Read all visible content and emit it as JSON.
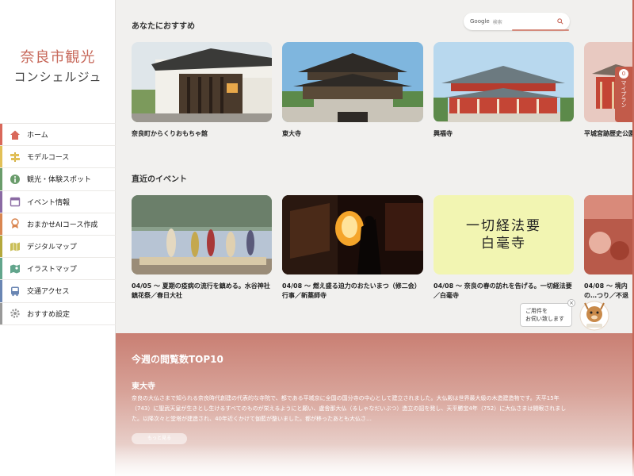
{
  "brand": {
    "main": "奈良市観光",
    "sub": "コンシェルジュ"
  },
  "nav": [
    {
      "label": "ホーム",
      "icon": "home-icon"
    },
    {
      "label": "モデルコース",
      "icon": "signpost-icon"
    },
    {
      "label": "観光・体験スポット",
      "icon": "info-icon"
    },
    {
      "label": "イベント情報",
      "icon": "calendar-icon"
    },
    {
      "label": "おまかせAIコース作成",
      "icon": "ai-badge-icon"
    },
    {
      "label": "デジタルマップ",
      "icon": "map-icon"
    },
    {
      "label": "イラストマップ",
      "icon": "illustration-map-icon"
    },
    {
      "label": "交通アクセス",
      "icon": "bus-icon"
    },
    {
      "label": "おすすめ設定",
      "icon": "gear-icon"
    }
  ],
  "search": {
    "brand": "Google",
    "placeholder": "検索"
  },
  "recommend": {
    "title": "あなたにおすすめ",
    "items": [
      {
        "name": "奈良町からくりおもちゃ館"
      },
      {
        "name": "東大寺"
      },
      {
        "name": "興福寺"
      },
      {
        "name": "平城宮跡歴史公園"
      }
    ]
  },
  "events": {
    "title": "直近のイベント",
    "items": [
      {
        "caption": "04/05 〜 夏期の疫病の流行を鎮める。水谷神社鎮花祭／春日大社"
      },
      {
        "caption": "04/08 〜 燃え盛る迫力のおたいまつ（修二会）行事／新薬師寺"
      },
      {
        "caption": "04/08 〜 奈良の春の訪れを告げる。一切経法要／白毫寺",
        "poster_line1": "一切経法要",
        "poster_line2": "白毫寺"
      },
      {
        "caption": "04/08 〜 境内の…つり／不退寺"
      }
    ]
  },
  "ranking": {
    "title": "今週の閲覧数TOP10",
    "name": "東大寺",
    "desc": "奈良の大仏さまで知られる奈良時代創建の代表的な寺院で、都である平城京に全国の国分寺の中心として建立されました。大仏殿は世界最大級の木造建造物です。天平15年（743）に聖武天皇が生きとし生けるすべてのものが栄えるようにと願い、盧舎那大仏（るしゃなだいぶつ）造立の詔を発し、天平勝宝4年（752）に大仏さまは開眼されました。以降次々と堂塔が建造され、40年近くかけて伽藍が整いました。都が移ったあとも大仏さ…",
    "button": "もっと見る"
  },
  "help": {
    "line1": "ご用件を",
    "line2": "お伺い致します",
    "close": "×"
  },
  "myplan": {
    "count": "0",
    "label": "マイプラン"
  },
  "colors": {
    "brand": "#c7685a",
    "accent": "#c25b4a"
  }
}
